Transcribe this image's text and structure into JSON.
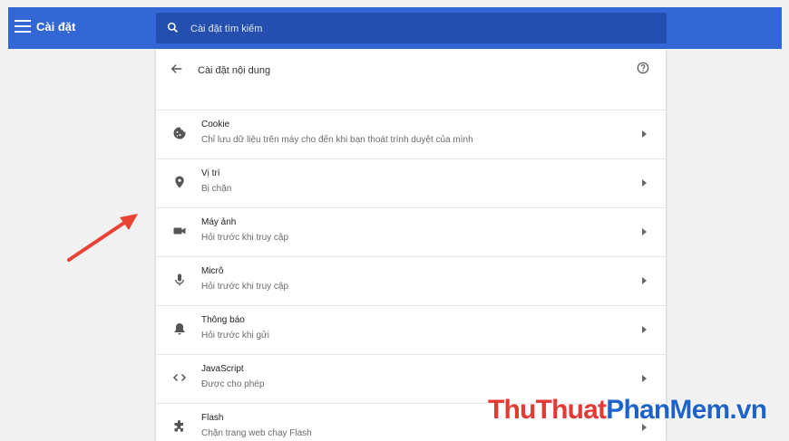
{
  "app": {
    "title": "Cài đặt"
  },
  "search": {
    "placeholder": "Cài đặt tìm kiếm"
  },
  "page": {
    "title": "Cài đặt nội dung"
  },
  "items": [
    {
      "title": "Cookie",
      "subtitle": "Chỉ lưu dữ liệu trên máy cho đến khi bạn thoát trình duyệt của mình",
      "icon": "cookie-icon"
    },
    {
      "title": "Vị trí",
      "subtitle": "Bị chặn",
      "icon": "location-icon"
    },
    {
      "title": "Máy ảnh",
      "subtitle": "Hỏi trước khi truy cập",
      "icon": "camera-icon"
    },
    {
      "title": "Micrô",
      "subtitle": "Hỏi trước khi truy cập",
      "icon": "microphone-icon"
    },
    {
      "title": "Thông báo",
      "subtitle": "Hỏi trước khi gửi",
      "icon": "bell-icon"
    },
    {
      "title": "JavaScript",
      "subtitle": "Được cho phép",
      "icon": "code-icon"
    },
    {
      "title": "Flash",
      "subtitle": "Chặn trang web chạy Flash",
      "icon": "puzzle-icon"
    }
  ],
  "watermark": {
    "part1": "ThuThuat",
    "part2": "PhanMem",
    "part3": ".vn"
  },
  "colors": {
    "topbar": "#3367d6",
    "search_bg": "#254fae",
    "arrow": "#ea4335"
  }
}
